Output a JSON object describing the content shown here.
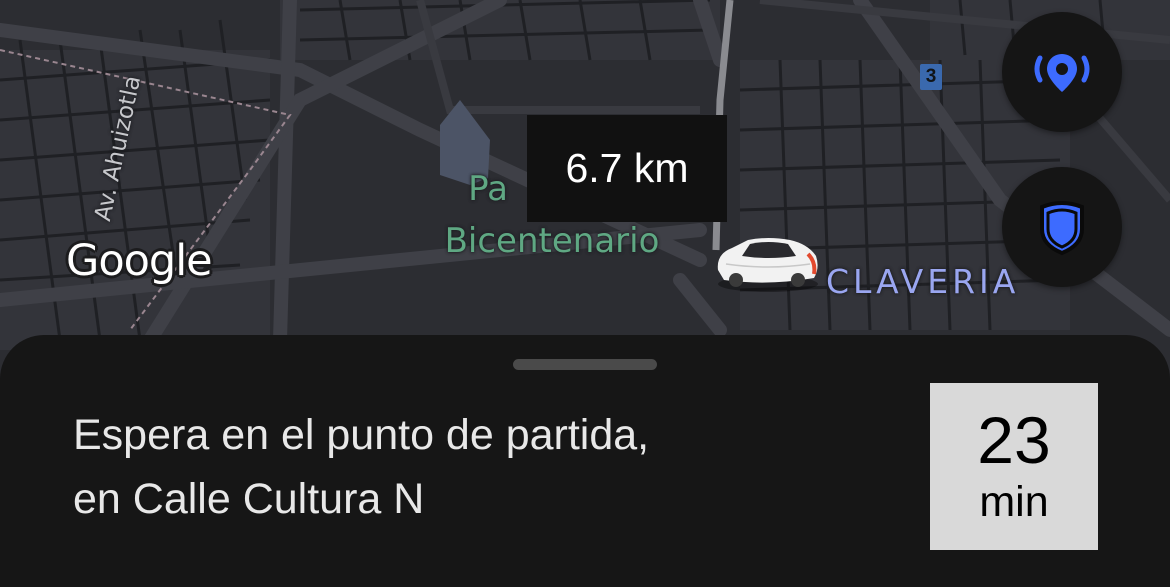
{
  "map": {
    "google_logo": "Google",
    "park_label_line1": "Pa",
    "park_label_line2": "Bicentenario",
    "street_label": "Av. Ahuizotla",
    "neighborhood_label": "CLAVERIA",
    "route_badge": "3",
    "distance": "6.7 km"
  },
  "buttons": {
    "location_icon": "broadcast-location-icon",
    "safety_icon": "shield-icon",
    "accent_color": "#3d6bff"
  },
  "sheet": {
    "instruction_line1": "Espera en el punto de partida,",
    "instruction_line2": "en Calle Cultura N",
    "eta_value": "23",
    "eta_unit": "min"
  }
}
